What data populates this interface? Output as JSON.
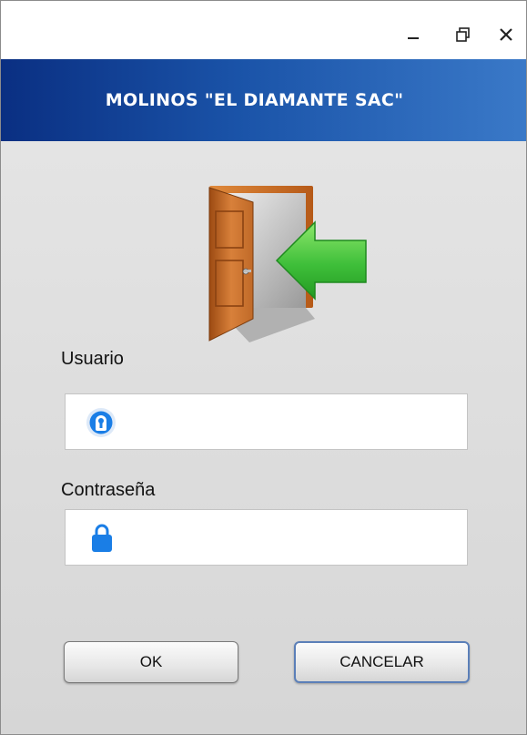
{
  "window": {
    "title": "",
    "controls": [
      "minimize",
      "restore",
      "close"
    ]
  },
  "header": {
    "title": "MOLINOS \"EL DIAMANTE SAC\""
  },
  "logo": {
    "icon": "door-enter-icon",
    "colors": {
      "door": "#c8641e",
      "arrow": "#3fbf3a"
    }
  },
  "form": {
    "user_label": "Usuario",
    "user_value": "",
    "user_icon": "user-keyhole-icon",
    "password_label": "Contraseña",
    "password_value": "",
    "password_icon": "lock-icon"
  },
  "buttons": {
    "ok_label": "OK",
    "cancel_label": "CANCELAR"
  },
  "colors": {
    "header_gradient": [
      "#0a2f82",
      "#3a79c8"
    ],
    "field_icon_blue": "#1a7ee6",
    "body_bg": "#e4e4e4"
  }
}
